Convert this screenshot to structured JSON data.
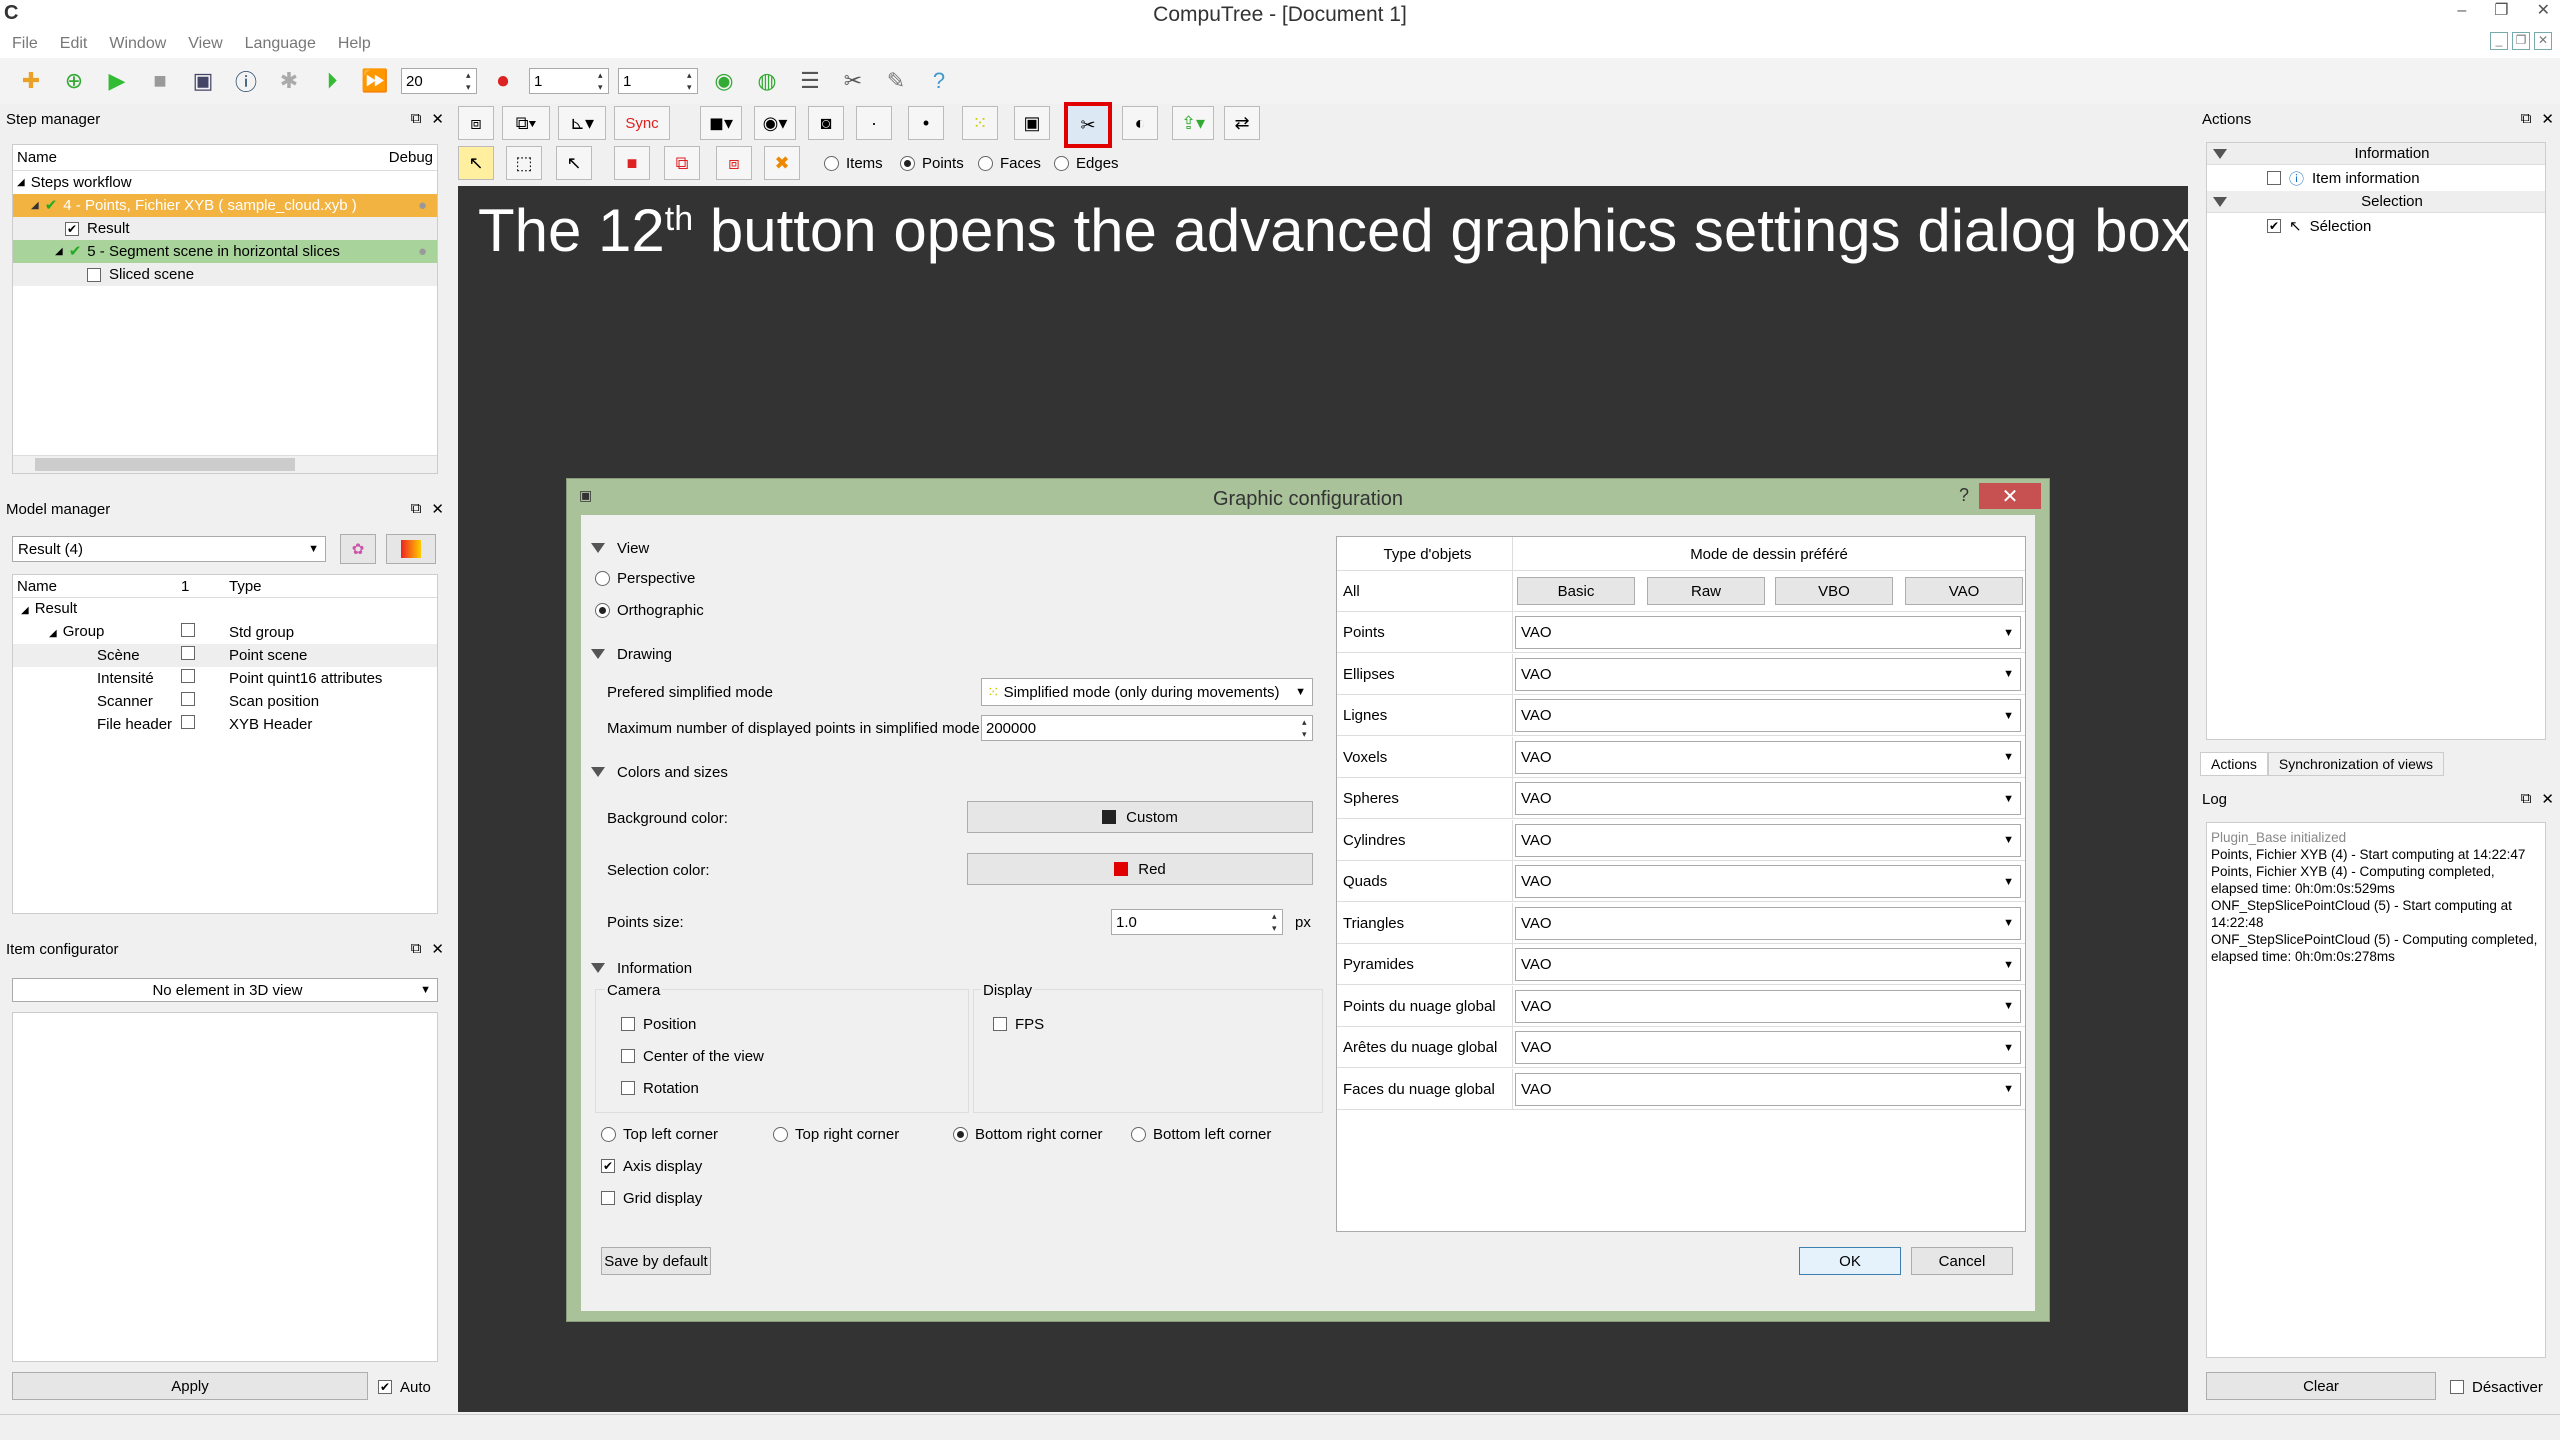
{
  "window": {
    "title": "CompuTree - [Document 1]"
  },
  "menu": [
    "File",
    "Edit",
    "Window",
    "View",
    "Language",
    "Help"
  ],
  "toolbar": {
    "spin1": "20",
    "spin2": "1",
    "spin3": "1"
  },
  "step_manager": {
    "title": "Step manager",
    "col_name": "Name",
    "col_debug": "Debug",
    "workflow": "Steps workflow",
    "step4": "4 - Points, Fichier XYB ( sample_cloud.xyb )",
    "result": "Result",
    "step5": "5 - Segment scene in horizontal slices",
    "sliced": "Sliced scene"
  },
  "model_manager": {
    "title": "Model manager",
    "result_select": "Result (4)",
    "col_name": "Name",
    "col_1": "1",
    "col_type": "Type",
    "rows": [
      {
        "name": "Result",
        "type": ""
      },
      {
        "name": "Group",
        "type": "Std group"
      },
      {
        "name": "Scène",
        "type": "Point scene"
      },
      {
        "name": "Intensité",
        "type": "Point quint16 attributes"
      },
      {
        "name": "Scanner",
        "type": "Scan position"
      },
      {
        "name": "File header",
        "type": "XYB Header"
      }
    ]
  },
  "item_configurator": {
    "title": "Item configurator",
    "select": "No element in 3D view",
    "apply": "Apply",
    "auto": "Auto"
  },
  "viewer": {
    "sync": "Sync",
    "radio_items": "Items",
    "radio_points": "Points",
    "radio_faces": "Faces",
    "radio_edges": "Edges",
    "caption_pre": "The 12",
    "caption_sup": "th",
    "caption_post": " button opens the advanced graphics settings dialog box:"
  },
  "dialog": {
    "title": "Graphic configuration",
    "help": "?",
    "close": "✕",
    "view": "View",
    "perspective": "Perspective",
    "orthographic": "Orthographic",
    "drawing": "Drawing",
    "pref_simplified": "Prefered simplified mode",
    "simplified_value": "Simplified mode (only during movements)",
    "max_points_label": "Maximum number of displayed points in simplified mode:",
    "max_points_value": "200000",
    "colors_sizes": "Colors and sizes",
    "bg_color": "Background color:",
    "bg_color_value": "Custom",
    "sel_color": "Selection color:",
    "sel_color_value": "Red",
    "points_size": "Points size:",
    "points_size_value": "1.0",
    "px": "px",
    "information": "Information",
    "camera": "Camera",
    "display": "Display",
    "position": "Position",
    "center_view": "Center of the view",
    "rotation": "Rotation",
    "fps": "FPS",
    "top_left": "Top left corner",
    "top_right": "Top right corner",
    "bottom_right": "Bottom right corner",
    "bottom_left": "Bottom left corner",
    "axis_display": "Axis display",
    "grid_display": "Grid display",
    "save_default": "Save by default",
    "ok": "OK",
    "cancel": "Cancel",
    "table_col1": "Type d'objets",
    "table_col2": "Mode de dessin préféré",
    "all": "All",
    "mode_buttons": [
      "Basic",
      "Raw",
      "VBO",
      "VAO"
    ],
    "rows": [
      {
        "type": "Points",
        "mode": "VAO"
      },
      {
        "type": "Ellipses",
        "mode": "VAO"
      },
      {
        "type": "Lignes",
        "mode": "VAO"
      },
      {
        "type": "Voxels",
        "mode": "VAO"
      },
      {
        "type": "Spheres",
        "mode": "VAO"
      },
      {
        "type": "Cylindres",
        "mode": "VAO"
      },
      {
        "type": "Quads",
        "mode": "VAO"
      },
      {
        "type": "Triangles",
        "mode": "VAO"
      },
      {
        "type": "Pyramides",
        "mode": "VAO"
      },
      {
        "type": "Points du nuage global",
        "mode": "VAO"
      },
      {
        "type": "Arêtes du nuage global",
        "mode": "VAO"
      },
      {
        "type": "Faces du nuage global",
        "mode": "VAO"
      }
    ]
  },
  "actions": {
    "title": "Actions",
    "information": "Information",
    "item_information": "Item information",
    "selection_header": "Selection",
    "selection_item": "Sélection",
    "tab_actions": "Actions",
    "tab_sync": "Synchronization of views"
  },
  "log": {
    "title": "Log",
    "entries": [
      "Plugin_Base initialized",
      "Points, Fichier XYB (4) - Start computing at 14:22:47",
      "Points, Fichier XYB (4) - Computing completed, elapsed time: 0h:0m:0s:529ms",
      "ONF_StepSlicePointCloud (5) - Start computing at 14:22:48",
      "ONF_StepSlicePointCloud (5) - Computing completed, elapsed time: 0h:0m:0s:278ms"
    ],
    "clear": "Clear",
    "deactivate": "Désactiver"
  },
  "colors": {
    "accent_red": "#e00000",
    "highlight_orange": "#f2b341",
    "highlight_green": "#a8d39a",
    "dialog_frame": "#a9c29a"
  }
}
